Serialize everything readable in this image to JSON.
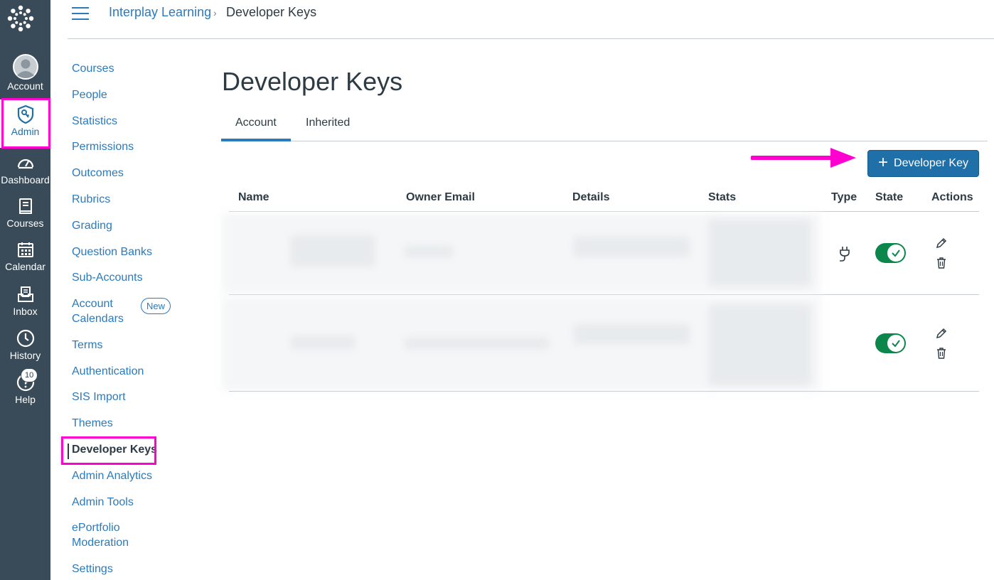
{
  "global_nav": {
    "items": [
      {
        "label": "Account"
      },
      {
        "label": "Admin"
      },
      {
        "label": "Dashboard"
      },
      {
        "label": "Courses"
      },
      {
        "label": "Calendar"
      },
      {
        "label": "Inbox"
      },
      {
        "label": "History"
      },
      {
        "label": "Help",
        "badge": "10"
      }
    ]
  },
  "breadcrumb": {
    "root": "Interplay Learning",
    "separator": "›",
    "current": "Developer Keys"
  },
  "section_nav": {
    "items": [
      {
        "label": "Courses"
      },
      {
        "label": "People"
      },
      {
        "label": "Statistics"
      },
      {
        "label": "Permissions"
      },
      {
        "label": "Outcomes"
      },
      {
        "label": "Rubrics"
      },
      {
        "label": "Grading"
      },
      {
        "label": "Question Banks"
      },
      {
        "label": "Sub-Accounts"
      },
      {
        "label": "Account",
        "label2": "Calendars",
        "pill": "New"
      },
      {
        "label": "Terms"
      },
      {
        "label": "Authentication"
      },
      {
        "label": "SIS Import"
      },
      {
        "label": "Themes"
      },
      {
        "label": "Developer Keys",
        "active": true
      },
      {
        "label": "Admin Analytics"
      },
      {
        "label": "Admin Tools"
      },
      {
        "label": "ePortfolio",
        "label2": "Moderation"
      },
      {
        "label": "Settings"
      }
    ]
  },
  "main": {
    "title": "Developer Keys",
    "tabs": [
      {
        "label": "Account"
      },
      {
        "label": "Inherited"
      }
    ],
    "add_button": {
      "label": "Developer Key"
    },
    "table": {
      "headers": [
        "Name",
        "Owner Email",
        "Details",
        "Stats",
        "Type",
        "State",
        "Actions"
      ],
      "rows": [
        {
          "type_icon": "plug-icon",
          "state": "on"
        },
        {
          "type_icon": "",
          "state": "on"
        }
      ]
    }
  },
  "colors": {
    "nav_bg": "#394b58",
    "link": "#2b7abc",
    "button": "#1f6fa8",
    "toggle_on": "#0b874b",
    "annotation": "#ff00d0"
  }
}
